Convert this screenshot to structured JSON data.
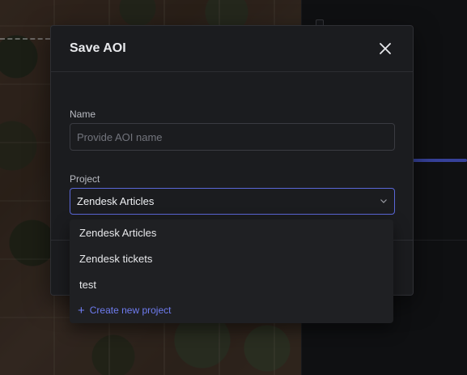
{
  "modal": {
    "title": "Save AOI",
    "name_label": "Name",
    "name_placeholder": "Provide AOI name",
    "name_value": "",
    "project_label": "Project",
    "project_selected": "Zendesk Articles"
  },
  "dropdown": {
    "options": [
      "Zendesk Articles",
      "Zendesk tickets",
      "test"
    ],
    "create_label": "Create new project"
  },
  "colors": {
    "accent": "#5a67d8",
    "link": "#6f7cf0",
    "modal_bg": "#1b1c1f"
  }
}
